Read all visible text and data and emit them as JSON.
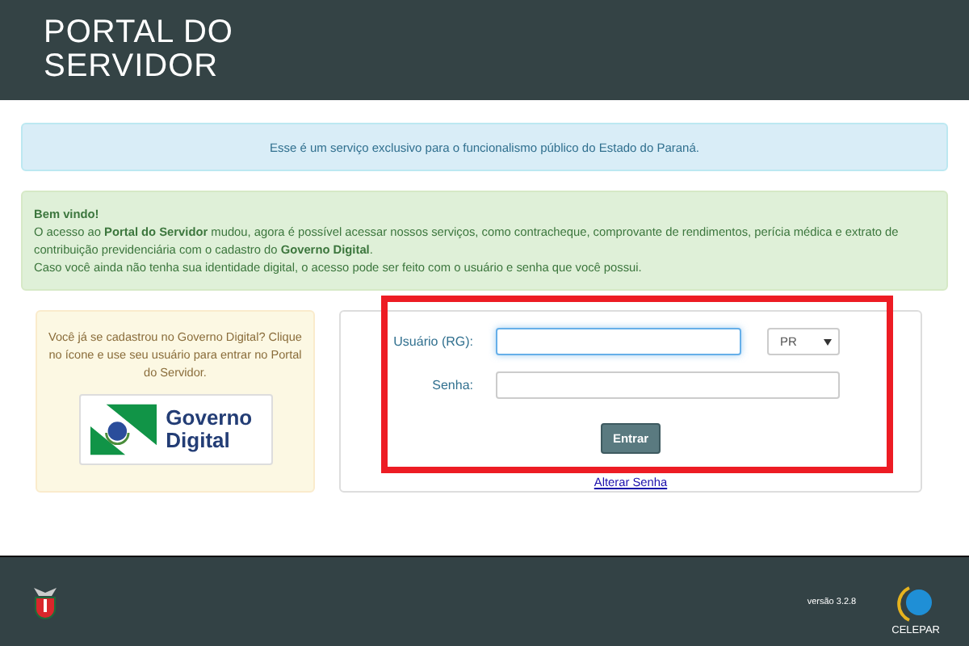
{
  "header": {
    "title": "PORTAL DO SERVIDOR"
  },
  "info_notice": "Esse é um serviço exclusivo para o funcionalismo público do Estado do Paraná.",
  "welcome": {
    "heading": "Bem vindo!",
    "lines": [
      "O acesso ao **Portal do Servidor** mudou, agora é possível acessar nossos serviços, como contracheque, comprovante de rendimentos, perícia médica e extrato de contribuição previdenciária com o cadastro do **Governo Digital**.",
      "Caso você ainda não tenha sua identidade digital, o acesso pode ser feito com o usuário e senha que você possui."
    ]
  },
  "governo_digital": {
    "text": "Você já se cadastrou no Governo Digital? Clique no ícone e use seu usuário para entrar no Portal do Servidor.",
    "logo_text": "Governo Digital"
  },
  "login": {
    "user_label": "Usuário (RG):",
    "user_focused": true,
    "state": "PR",
    "password_label": "Senha:",
    "submit": "Entrar",
    "change_password": "Alterar Senha"
  },
  "highlight": {
    "shown": true
  },
  "footer": {
    "version": "versão 3.2.8",
    "company": "CELEPAR"
  }
}
